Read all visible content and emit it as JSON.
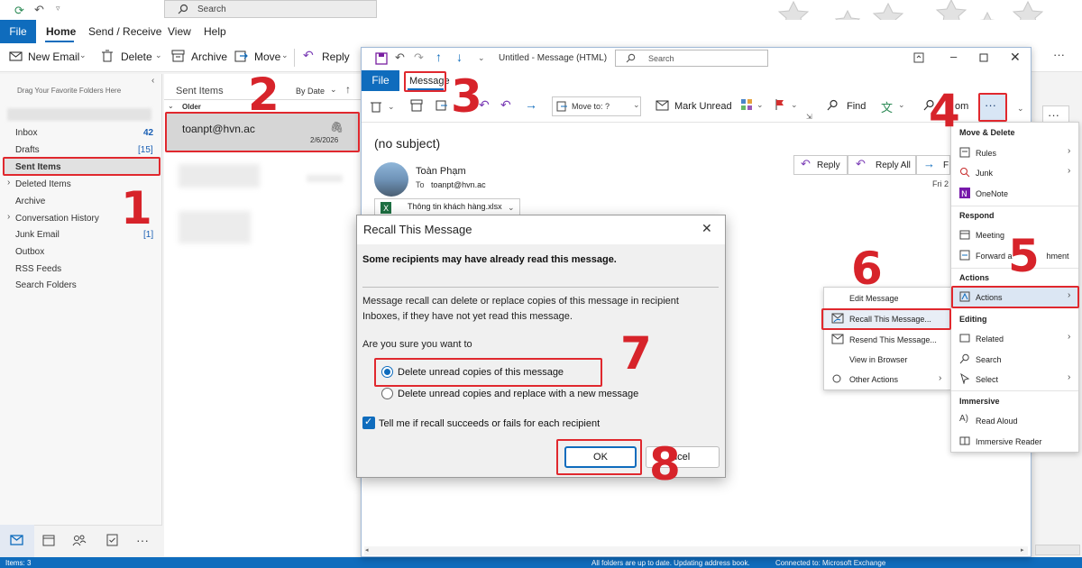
{
  "main": {
    "search_placeholder": "Search",
    "menu": [
      "File",
      "Home",
      "Send / Receive",
      "View",
      "Help"
    ],
    "ribbon": {
      "new_email": "New Email",
      "delete": "Delete",
      "archive": "Archive",
      "move": "Move",
      "reply": "Reply"
    },
    "folder_hint": "Drag Your Favorite Folders Here",
    "folders": [
      {
        "label": "Inbox",
        "count": "42"
      },
      {
        "label": "Drafts",
        "count": "[15]"
      },
      {
        "label": "Sent Items",
        "count": ""
      },
      {
        "label": "Deleted Items",
        "count": ""
      },
      {
        "label": "Archive",
        "count": ""
      },
      {
        "label": "Conversation History",
        "count": ""
      },
      {
        "label": "Junk Email",
        "count": "[1]"
      },
      {
        "label": "Outbox",
        "count": ""
      },
      {
        "label": "RSS Feeds",
        "count": ""
      },
      {
        "label": "Search Folders",
        "count": ""
      }
    ],
    "list_title": "Sent Items",
    "sort": "By Date",
    "group_older": "Older",
    "selected_item": {
      "to": "toanpt@hvn.ac",
      "date": "2/6/2026"
    },
    "status_left": "Items: 3",
    "status_mid": "All folders are up to date.  Updating address book.",
    "status_right": "Connected to: Microsoft Exchange"
  },
  "msgwin": {
    "title": "Untitled  -  Message (HTML)",
    "search_placeholder": "Search",
    "tabs": [
      "File",
      "Message"
    ],
    "move_to": "Move to: ?",
    "mark_unread": "Mark Unread",
    "find": "Find",
    "zoom": "om",
    "subject": "(no subject)",
    "sender": "Toàn Phạm",
    "to_label": "To",
    "to_value": "toanpt@hvn.ac",
    "attachment": "Thông tin khách hàng.xlsx",
    "reply": "Reply",
    "reply_all": "Reply All",
    "forward_stub": "F",
    "date_stub": "Fri 2"
  },
  "dialog": {
    "title": "Recall This Message",
    "warning": "Some recipients may have already read this message.",
    "desc_line1": "Message recall can delete or replace copies of this message in recipient",
    "desc_line2": "Inboxes, if they have not yet read this message.",
    "question": "Are you sure you want to",
    "option1": "Delete unread copies of this message",
    "option2": "Delete unread copies and replace with a new message",
    "checkbox": "Tell me if recall succeeds or fails for each recipient",
    "ok": "OK",
    "cancel": "Cancel",
    "cancel_visible": "ncel"
  },
  "actions_submenu": [
    "Edit Message",
    "Recall This Message...",
    "Resend This Message...",
    "View in Browser",
    "Other Actions"
  ],
  "more_menu": {
    "sections": [
      {
        "header": "Move & Delete",
        "items": [
          "Rules",
          "Junk",
          "OneNote"
        ]
      },
      {
        "header": "Respond",
        "items": [
          "Meeting",
          "Forward as Attachment"
        ]
      },
      {
        "header": "Actions",
        "items": [
          "Actions"
        ]
      },
      {
        "header": "Editing",
        "items": [
          "Related",
          "Search",
          "Select"
        ]
      },
      {
        "header": "Immersive",
        "items": [
          "Read Aloud",
          "Immersive Reader"
        ]
      }
    ],
    "forward_visible_a": "Forward a",
    "forward_visible_b": "hment"
  },
  "steps": [
    "1",
    "2",
    "3",
    "4",
    "5",
    "6",
    "7",
    "8"
  ],
  "colors": {
    "accent": "#0f6cbd",
    "highlight": "#e0282e",
    "step_number": "#d7232a"
  }
}
